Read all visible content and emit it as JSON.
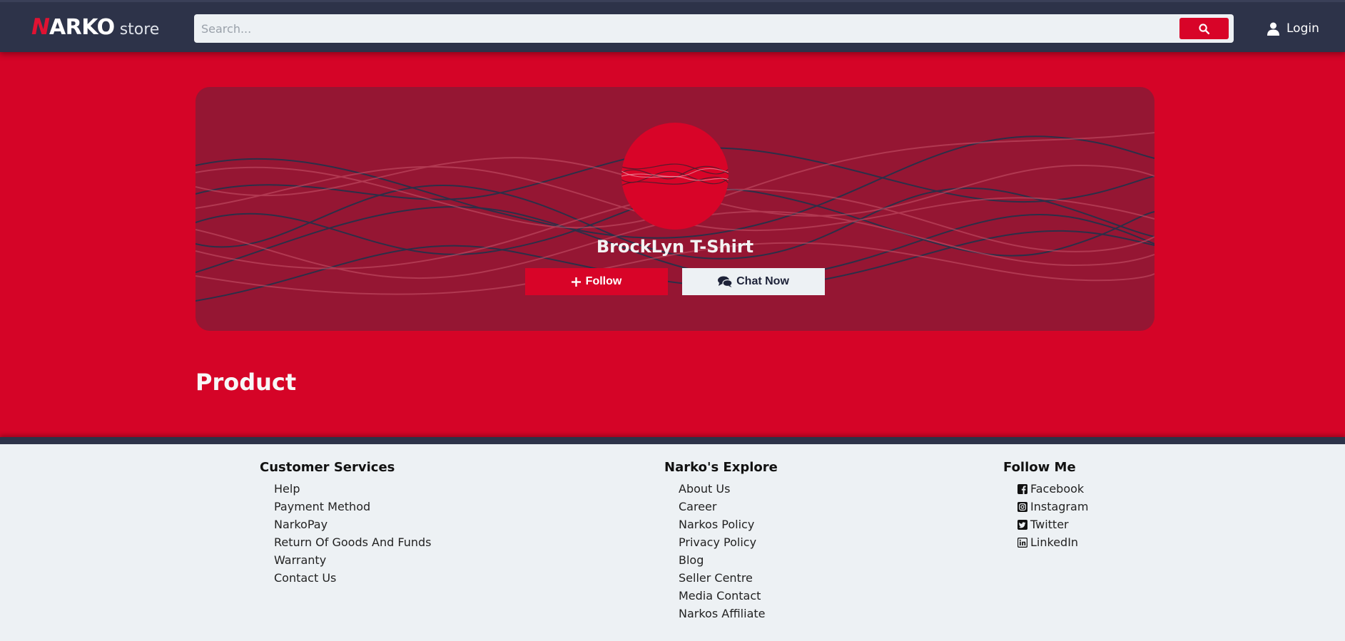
{
  "header": {
    "logo_n": "N",
    "logo_rest": "ARKO",
    "logo_store": "store",
    "search_placeholder": "Search...",
    "login_label": "Login"
  },
  "store": {
    "name": "BrockLyn T-Shirt",
    "follow_label": "Follow",
    "chat_label": "Chat Now"
  },
  "section": {
    "product_title": "Product"
  },
  "footer": {
    "columns": [
      {
        "title": "Customer Services",
        "items": [
          "Help",
          "Payment Method",
          "NarkoPay",
          "Return Of Goods And Funds",
          "Warranty",
          "Contact Us"
        ]
      },
      {
        "title": "Narko's Explore",
        "items": [
          "About Us",
          "Career",
          "Narkos Policy",
          "Privacy Policy",
          "Blog",
          "Seller Centre",
          "Media Contact",
          "Narkos Affiliate"
        ]
      },
      {
        "title": "Follow Me",
        "items": [
          {
            "label": "Facebook",
            "icon": "facebook-icon"
          },
          {
            "label": "Instagram",
            "icon": "instagram-icon"
          },
          {
            "label": "Twitter",
            "icon": "twitter-icon"
          },
          {
            "label": "LinkedIn",
            "icon": "linkedin-icon"
          }
        ]
      }
    ]
  },
  "colors": {
    "header_bg": "#2d3349",
    "accent_red": "#d80428",
    "card_bg": "#951633",
    "footer_bg": "#edf1f4"
  }
}
